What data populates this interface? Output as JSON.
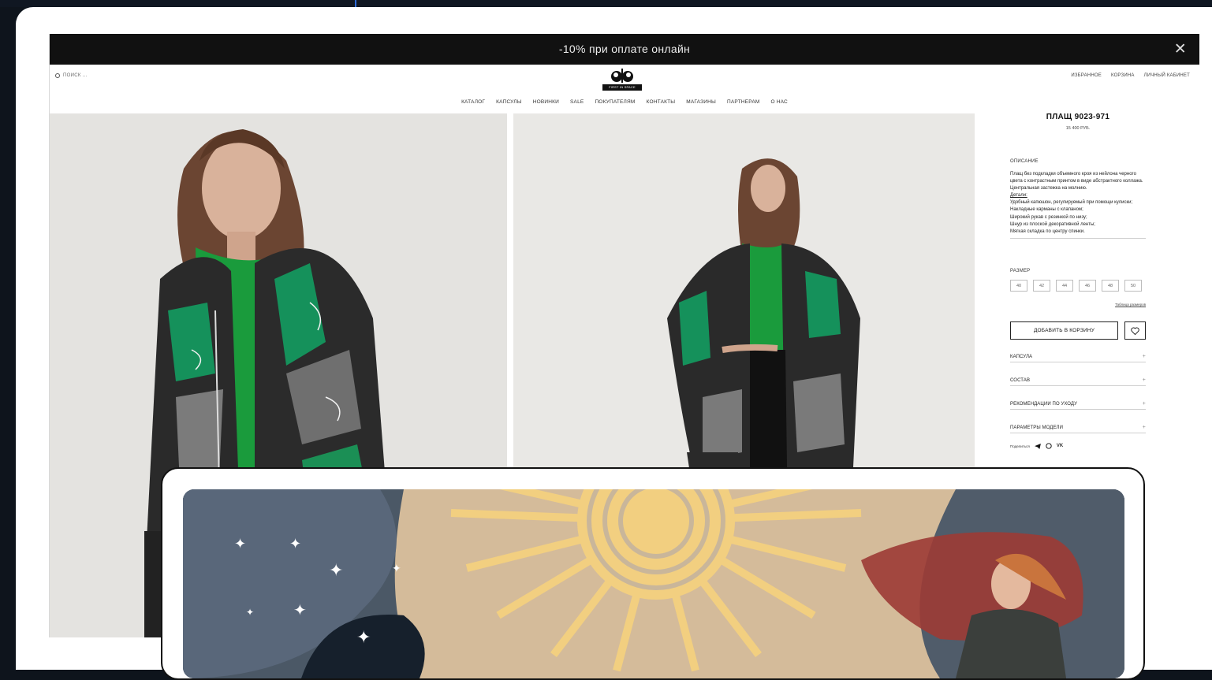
{
  "promo": {
    "text": "-10% при оплате онлайн"
  },
  "header": {
    "search_placeholder": "ПОИСК ...",
    "logo_text": "FIRST IN SPACE",
    "user_nav": [
      "ИЗБРАННОЕ",
      "КОРЗИНА",
      "ЛИЧНЫЙ КАБИНЕТ"
    ]
  },
  "nav": [
    "КАТАЛОГ",
    "КАПСУЛЫ",
    "НОВИНКИ",
    "SALE",
    "ПОКУПАТЕЛЯМ",
    "КОНТАКТЫ",
    "МАГАЗИНЫ",
    "ПАРТНЕРАМ",
    "О НАС"
  ],
  "product": {
    "title": "ПЛАЩ 9023-971",
    "price": "15 400 РУБ.",
    "description_heading": "ОПИСАНИЕ",
    "description": "Плащ без подкладки объемного кроя из нейлона черного цвета с  контрастным принтом в виде абстрактного коллажа. Центральная застежка на молнию.",
    "details_label": "Детали:",
    "details": [
      "Удобный капюшон, регулируемый при помощи кулиски;",
      "Накладные карманы с клапаном;",
      "Широкий рукав с резинкой по низу;",
      "Шнур из плоской декоративной ленты;",
      "Мягкая складка по центру спинки."
    ],
    "size_heading": "РАЗМЕР",
    "sizes": [
      "40",
      "42",
      "44",
      "46",
      "48",
      "50"
    ],
    "size_table": "Таблица размеров",
    "add_to_cart": "ДОБАВИТЬ В КОРЗИНУ",
    "accordions": [
      "КАПСУЛА",
      "СОСТАВ",
      "РЕКОМЕНДАЦИИ ПО УХОДУ",
      "ПАРАМЕТРЫ МОДЕЛИ"
    ],
    "share_label": "Поделиться"
  },
  "colors": {
    "promo_bg": "#111111",
    "accent_green": "#1f9a4e",
    "banner_sun": "#f2cf80"
  }
}
